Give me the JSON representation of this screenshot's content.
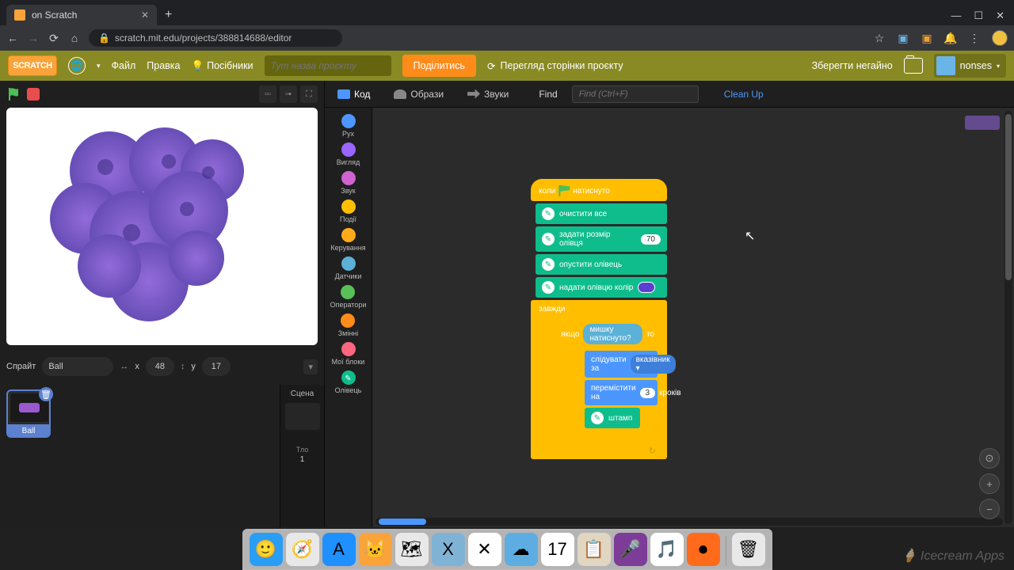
{
  "browser": {
    "tab_title": "on Scratch",
    "url_display": "scratch.mit.edu/projects/388814688/editor",
    "new_tab": "+",
    "win_min": "—",
    "win_max": "☐",
    "win_close": "✕"
  },
  "scratch_menu": {
    "logo": "SCRATCH",
    "file": "Файл",
    "edit": "Правка",
    "tutorials": "Посібники",
    "title_placeholder": "Тут назва проєкту",
    "share": "Поділитись",
    "see_project": "Перегляд сторінки проєкту",
    "save_now": "Зберегти негайно",
    "username": "nonses"
  },
  "stage_ctrl": {
    "layout1": "▫▫",
    "layout2": "▫▪",
    "fullscreen": "⛶"
  },
  "sprite_info": {
    "label": "Спрайт",
    "name": "Ball",
    "x_lbl": "x",
    "x": "48",
    "y_lbl": "y",
    "y": "17"
  },
  "sprite_tile": {
    "name": "Ball",
    "del": "🗑"
  },
  "stage_panel": {
    "header": "Сцена",
    "backdrops_lbl": "Тло",
    "backdrops_count": "1"
  },
  "editor_tabs": {
    "code": "Код",
    "costumes": "Образи",
    "sounds": "Звуки",
    "find": "Find",
    "find_placeholder": "Find (Ctrl+F)",
    "cleanup": "Clean Up"
  },
  "categories": [
    {
      "name": "Рух",
      "color": "#4c97ff"
    },
    {
      "name": "Вигляд",
      "color": "#9966ff"
    },
    {
      "name": "Звук",
      "color": "#cf63cf"
    },
    {
      "name": "Події",
      "color": "#ffbf00"
    },
    {
      "name": "Керування",
      "color": "#ffab19"
    },
    {
      "name": "Датчики",
      "color": "#5cb1d6"
    },
    {
      "name": "Оператори",
      "color": "#59c059"
    },
    {
      "name": "Змінні",
      "color": "#ff8c1a"
    },
    {
      "name": "Мої блоки",
      "color": "#ff6680"
    },
    {
      "name": "Олівець",
      "color": "#0fbd8c",
      "icon": "✎"
    }
  ],
  "blocks": {
    "hat_prefix": "коли",
    "hat_suffix": "натиснуто",
    "erase_all": "очистити все",
    "set_pen_size": "задати розмір олівця",
    "pen_size_val": "70",
    "pen_down": "опустити олівець",
    "set_pen_color": "надати олівцю колір",
    "forever": "завжди",
    "if": "якщо",
    "then": "то",
    "mouse_down": "мишку натиснуто?",
    "point_towards": "слідувати за",
    "pointer": "вказівник ▾",
    "move": "перемістити на",
    "move_val": "3",
    "steps": "кроків",
    "stamp": "штамп"
  },
  "zoom": {
    "target": "⊙",
    "in": "+",
    "out": "−"
  },
  "dock": [
    {
      "name": "finder",
      "bg": "#2a9df4",
      "glyph": "🙂"
    },
    {
      "name": "safari",
      "bg": "#e8e8e8",
      "glyph": "🧭"
    },
    {
      "name": "appstore",
      "bg": "#1e90ff",
      "glyph": "A"
    },
    {
      "name": "scratch",
      "bg": "#f9a33a",
      "glyph": "🐱"
    },
    {
      "name": "maps",
      "bg": "#e8e8e8",
      "glyph": "🗺"
    },
    {
      "name": "app-x1",
      "bg": "#7fb3d5",
      "glyph": "X"
    },
    {
      "name": "app-x2",
      "bg": "#ffffff",
      "glyph": "✕"
    },
    {
      "name": "app-cloud",
      "bg": "#5dade2",
      "glyph": "☁"
    },
    {
      "name": "calendar",
      "bg": "#ffffff",
      "glyph": "17"
    },
    {
      "name": "notes",
      "bg": "#e0d6c2",
      "glyph": "📋"
    },
    {
      "name": "siri",
      "bg": "#7d3c98",
      "glyph": "🎤"
    },
    {
      "name": "music",
      "bg": "#ffffff",
      "glyph": "🎵"
    },
    {
      "name": "recorder",
      "bg": "#ff6b1a",
      "glyph": "⏺"
    }
  ],
  "trash": "🗑",
  "watermark": "🍦 Icecream Apps"
}
